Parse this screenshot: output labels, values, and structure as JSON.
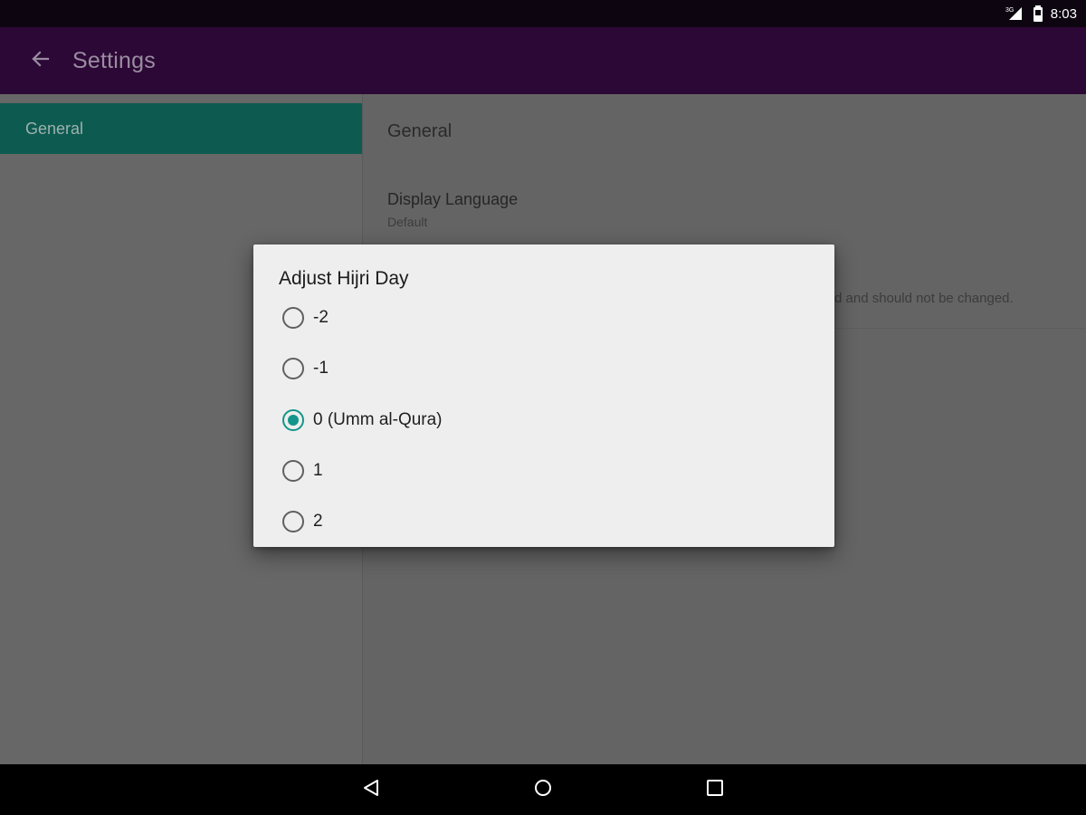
{
  "status_bar": {
    "network_label": "3G",
    "time": "8:03",
    "icons": [
      "signal-icon",
      "battery-icon"
    ]
  },
  "app_bar": {
    "title": "Settings",
    "back_icon": "arrow-back-icon",
    "color": "#2c0836"
  },
  "sidebar": {
    "items": [
      {
        "label": "General",
        "selected": true
      }
    ],
    "accent": "#0c5a50"
  },
  "detail": {
    "section_title": "General",
    "preferences": [
      {
        "title": "Display Language",
        "summary": "Default"
      }
    ],
    "partial_text": "d and should not be changed."
  },
  "dialog": {
    "title": "Adjust Hijri Day",
    "options": [
      {
        "label": "-2",
        "checked": false
      },
      {
        "label": "-1",
        "checked": false
      },
      {
        "label": "0 (Umm al-Qura)",
        "checked": true
      },
      {
        "label": "1",
        "checked": false
      },
      {
        "label": "2",
        "checked": false
      }
    ],
    "accent": "#13958a"
  },
  "nav_bar": {
    "icons": [
      "back-triangle-icon",
      "home-circle-icon",
      "recents-square-icon"
    ]
  }
}
